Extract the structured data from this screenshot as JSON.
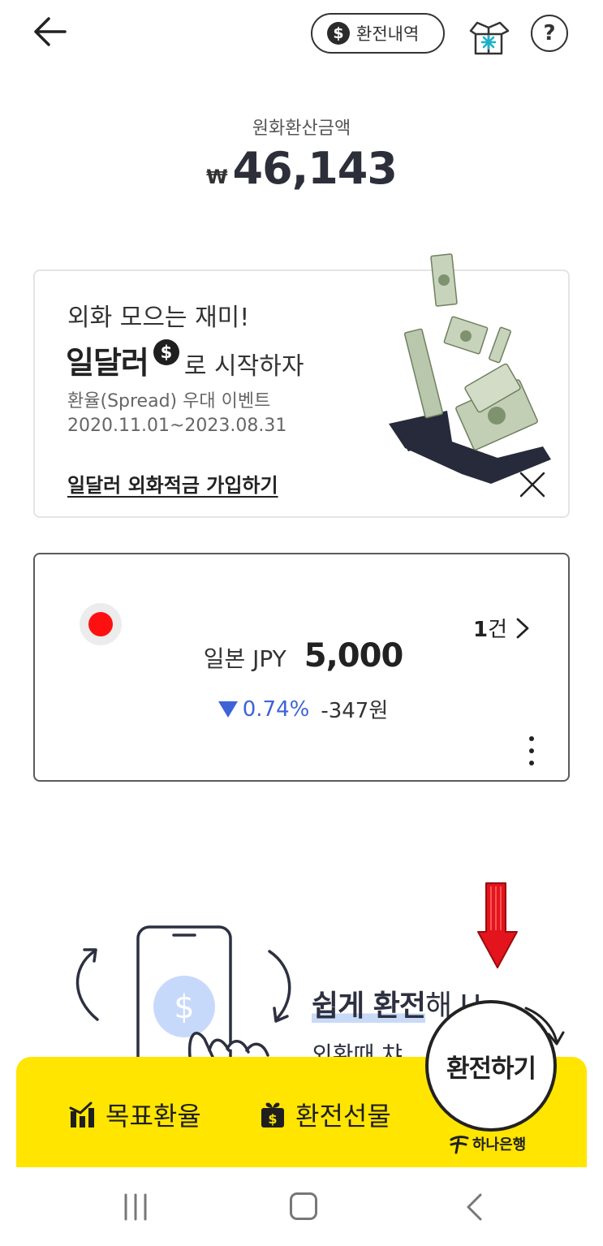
{
  "header": {
    "history_label": "환전내역",
    "history_icon": "dollar-circle-icon",
    "box_icon": "gift-box-icon",
    "help_label": "?"
  },
  "summary": {
    "label": "원화환산금액",
    "currency_symbol": "₩",
    "amount": "46,143"
  },
  "promo": {
    "line1": "외화 모으는 재미!",
    "brand": "일달러",
    "brand_icon_text": "$",
    "tail": "로 시작하자",
    "subtitle": "환율(Spread) 우대 이벤트",
    "period": "2020.11.01~2023.08.31",
    "link": "일달러 외화적금 가입하기"
  },
  "currency": {
    "name": "일본 JPY",
    "amount": "5,000",
    "count": "1",
    "count_unit": "건",
    "change_rate": "0.74%",
    "change_amount": "-347원",
    "flag_color": "#ff1010",
    "trend_color": "#3e63d8"
  },
  "ad": {
    "title_highlight": "쉽게 환전",
    "title_tail": "해 U",
    "subtitle": "외환때 챠"
  },
  "bottom_bar": {
    "target_label": "목표환율",
    "gift_label": "환전선물",
    "exchange_label": "환전하기",
    "bank_name": "하나은행",
    "bar_color": "#ffe500"
  }
}
